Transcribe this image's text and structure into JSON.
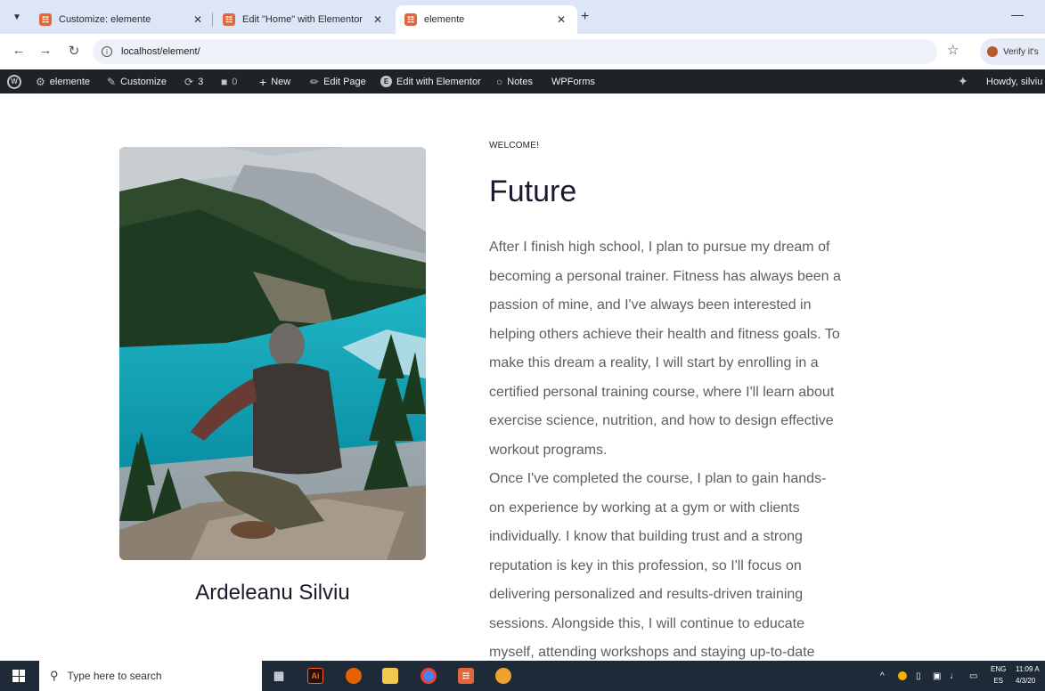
{
  "browser": {
    "tabs": [
      {
        "label": "Customize: elemente"
      },
      {
        "label": "Edit \"Home\" with Elementor"
      },
      {
        "label": "elemente"
      }
    ],
    "new_tab": "+",
    "url": "localhost/element/",
    "profile_label": "Verify it's"
  },
  "wpbar": {
    "site": "elemente",
    "customize": "Customize",
    "updates": "3",
    "comments": "0",
    "new": "New",
    "edit_page": "Edit Page",
    "edit_elementor": "Edit with Elementor",
    "notes": "Notes",
    "wpforms": "WPForms",
    "howdy": "Howdy, silviu"
  },
  "page": {
    "author": "Ardeleanu Silviu",
    "eyebrow": "WELCOME!",
    "title": "Future",
    "lines": [
      "After I finish high school, I plan to pursue my dream of",
      "becoming a personal trainer. Fitness has always been a",
      "passion of mine, and I've always been interested in",
      "helping others achieve their health and fitness goals. To",
      "make this dream a reality, I will start by enrolling in a",
      "certified personal training course, where I'll learn about",
      "exercise science, nutrition, and how to design effective",
      "workout programs.",
      "Once I've completed the course, I plan to gain hands-",
      "on experience by working at a gym or with clients",
      "individually. I know that building trust and a strong",
      "reputation is key in this profession, so I'll focus on",
      "delivering personalized and results-driven training",
      "sessions. Alongside this, I will continue to educate",
      "myself, attending workshops and staying up-to-date"
    ]
  },
  "taskbar": {
    "search_placeholder": "Type here to search",
    "lang_top": "ENG",
    "lang_bottom": "ES",
    "time": "11:09 A",
    "date": "4/3/20"
  }
}
